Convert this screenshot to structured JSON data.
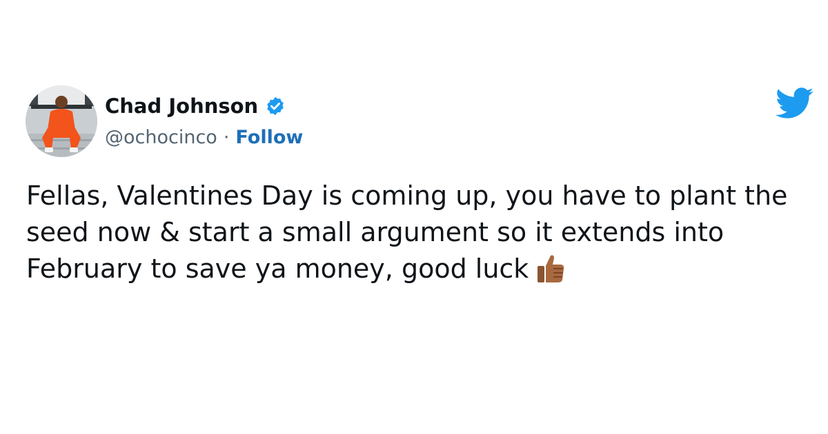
{
  "author": {
    "display_name": "Chad Johnson",
    "handle": "@ochocinco",
    "separator": "·",
    "follow_label": "Follow",
    "verified": true,
    "avatar": "profile photo of a man in an orange outfit sitting on steps"
  },
  "tweet": {
    "text": "Fellas, Valentines Day is coming up, you have to plant the seed now & start a small argument so it extends into February to save ya money, good luck",
    "trailing_emoji": "thumbs-up-medium-dark-skin-tone"
  },
  "icons": {
    "brand": "twitter-bird-icon",
    "verified": "verified-badge-icon",
    "emoji": "thumbs-up-icon"
  },
  "colors": {
    "text": "#0f1419",
    "secondary_text": "#536471",
    "link": "#1d6fb8",
    "twitter_blue": "#1d9bf0",
    "outfit_orange": "#f2541b"
  }
}
